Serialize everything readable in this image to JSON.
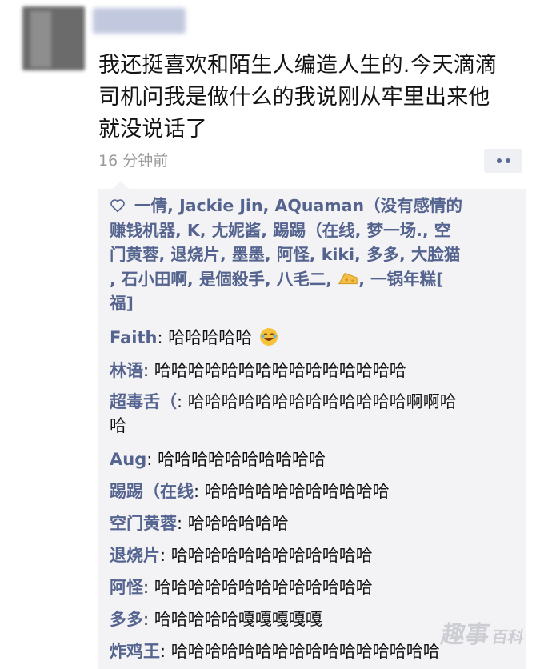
{
  "post": {
    "author": "",
    "lines": [
      "我还挺喜欢和陌生人编造人生的.今天滴滴",
      "司机问我是做什么的我说刚从牢里出来他",
      "就没说话了"
    ],
    "time": "16 分钟前"
  },
  "likes": {
    "lines": [
      "一倩, Jackie Jin, AQuaman（没有感情的",
      "赚钱机器, K, 尢妮酱, 踢踢（在线, 梦一场., 空",
      "门黄蓉, 退烧片, 墨墨, 阿怪, kiki, 多多, 大脸猫",
      ", 石小田啊, 是個殺手, 八毛二,"
    ],
    "after_icon": ", 一锅年糕[",
    "last_line": "福]"
  },
  "comments": [
    {
      "name": "Faith",
      "sep": ": ",
      "text": "哈哈哈哈哈"
    },
    {
      "name": "林语",
      "sep": ": ",
      "text": "哈哈哈哈哈哈哈哈哈哈哈哈哈哈哈"
    },
    {
      "name": "超毒舌（",
      "sep": ": ",
      "text": "哈哈哈哈哈哈哈哈哈哈哈哈哈啊啊哈",
      "cont": "哈"
    },
    {
      "name": "Aug",
      "sep": ": ",
      "text": "哈哈哈哈哈哈哈哈哈哈"
    },
    {
      "name": "踢踢（在线",
      "sep": ": ",
      "text": "哈哈哈哈哈哈哈哈哈哈哈"
    },
    {
      "name": "空门黄蓉",
      "sep": ": ",
      "text": "哈哈哈哈哈哈"
    },
    {
      "name": "退烧片",
      "sep": ": ",
      "text": "哈哈哈哈哈哈哈哈哈哈哈哈"
    },
    {
      "name": "阿怪",
      "sep": ": ",
      "text": "哈哈哈哈哈哈哈哈哈哈哈哈哈"
    },
    {
      "name": "多多",
      "sep": ": ",
      "text": "哈哈哈哈哈嘎嘎嘎嘎嘎"
    },
    {
      "name": "炸鸡王",
      "sep": ": ",
      "text": "哈哈哈哈哈哈哈哈哈哈哈哈哈哈哈哈"
    }
  ],
  "watermark": {
    "main": "趣事",
    "sub": "百科"
  },
  "icons": {
    "like": "heart-outline-icon",
    "more": "more-dots-icon",
    "emoji": "laughing-emoji-icon",
    "cheese": "cheese-emoji-icon"
  }
}
